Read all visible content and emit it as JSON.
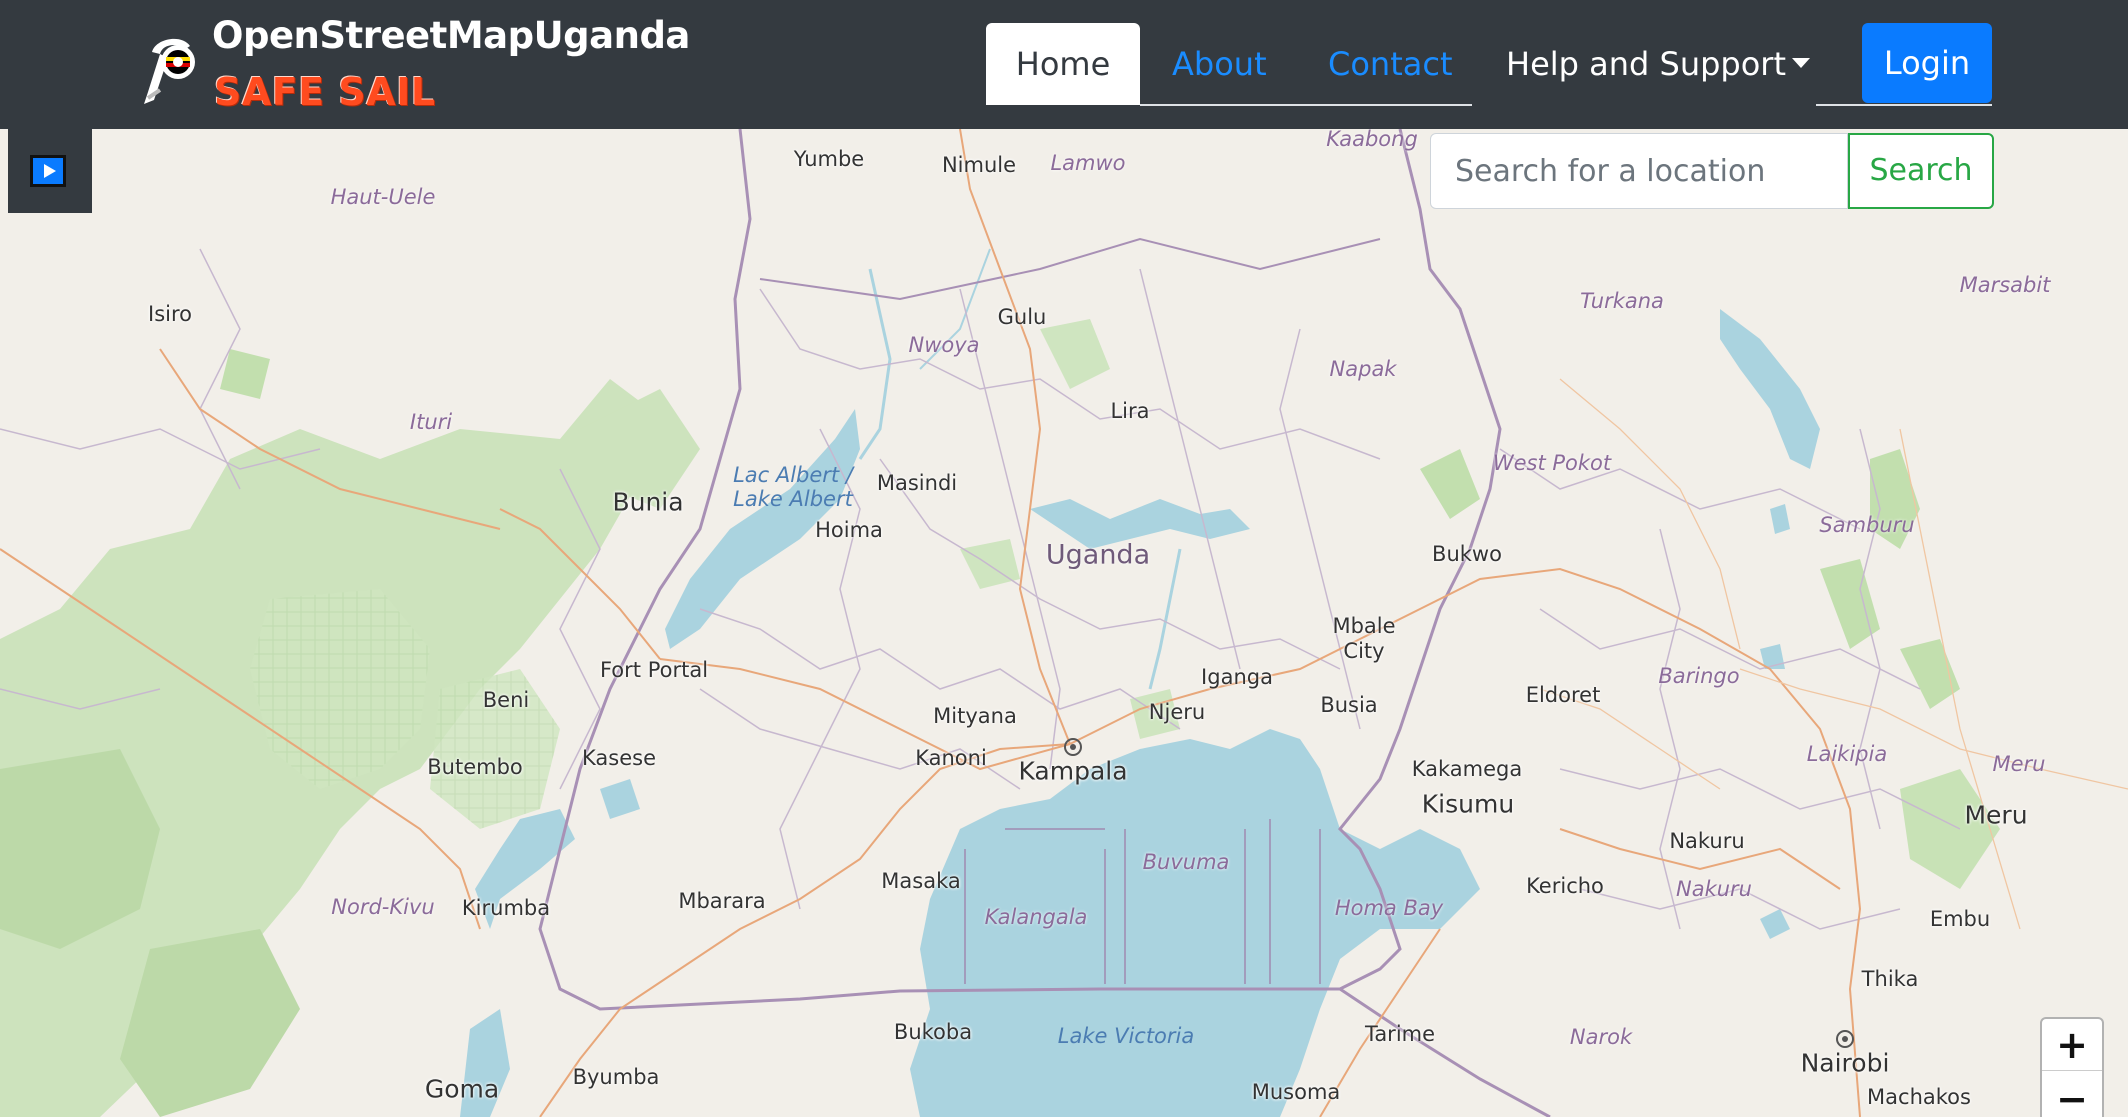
{
  "brand": {
    "title": "OpenStreetMapUganda",
    "subtitle": "SAFE SAIL",
    "logo_icon": "uganda-mapper-logo-icon"
  },
  "nav": {
    "home": "Home",
    "about": "About",
    "contact": "Contact",
    "help": "Help and Support",
    "login": "Login"
  },
  "search": {
    "placeholder": "Search for a location",
    "button": "Search"
  },
  "map": {
    "play_icon": "play-icon",
    "zoom_in": "+",
    "zoom_out": "−",
    "country": "Uganda",
    "cities": [
      "Yumbe",
      "Nimule",
      "Gulu",
      "Lira",
      "Masindi",
      "Hoima",
      "Bunia",
      "Isiro",
      "Bukwo",
      "Mbale City",
      "Iganga",
      "Njeru",
      "Busia",
      "Mityana",
      "Kanoni",
      "Kampala",
      "Fort Portal",
      "Beni",
      "Kasese",
      "Butembo",
      "Kirumba",
      "Mbarara",
      "Masaka",
      "Bukoba",
      "Byumba",
      "Goma",
      "Tarime",
      "Musoma",
      "Eldoret",
      "Kakamega",
      "Kisumu",
      "Kericho",
      "Nakuru",
      "Meru",
      "Embu",
      "Thika",
      "Nairobi",
      "Machakos"
    ],
    "regions": [
      "Kaabong",
      "Lamwo",
      "Haut-Uele",
      "Nwoya",
      "Napak",
      "Turkana",
      "Marsabit",
      "Ituri",
      "West Pokot",
      "Samburu",
      "Baringo",
      "Laikipia",
      "Meru",
      "Buvuma",
      "Kalangala",
      "Homa Bay",
      "Nakuru",
      "Nord-Kivu",
      "Narok"
    ],
    "water": [
      "Lac Albert / Lake Albert",
      "Lake Victoria"
    ]
  },
  "colors": {
    "navbar": "#343a40",
    "primary": "#0a7bff",
    "link": "#1a8cff",
    "search_green": "#28a745",
    "brand_orange": "#ff4b1f",
    "water": "#aad3df",
    "park": "#c8e6b0"
  }
}
